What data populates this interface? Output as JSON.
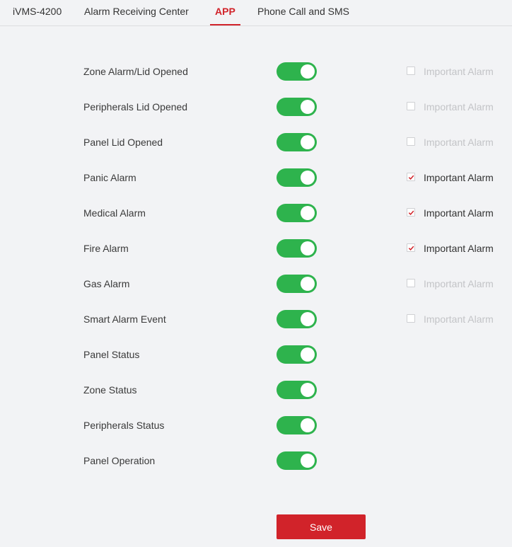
{
  "colors": {
    "accent": "#d1232a",
    "toggle_on": "#2eb34d",
    "save_bg": "#d1232a",
    "check_color": "#d1232a"
  },
  "tabs": [
    {
      "label": "iVMS-4200",
      "active": false
    },
    {
      "label": "Alarm Receiving Center",
      "active": false
    },
    {
      "label": "APP",
      "active": true
    },
    {
      "label": "Phone Call and SMS",
      "active": false
    }
  ],
  "rows": [
    {
      "label": "Zone Alarm/Lid Opened",
      "enabled": true,
      "important": {
        "label": "Important Alarm",
        "checked": false
      }
    },
    {
      "label": "Peripherals Lid Opened",
      "enabled": true,
      "important": {
        "label": "Important Alarm",
        "checked": false
      }
    },
    {
      "label": "Panel Lid Opened",
      "enabled": true,
      "important": {
        "label": "Important Alarm",
        "checked": false
      }
    },
    {
      "label": "Panic Alarm",
      "enabled": true,
      "important": {
        "label": "Important Alarm",
        "checked": true
      }
    },
    {
      "label": "Medical Alarm",
      "enabled": true,
      "important": {
        "label": "Important Alarm",
        "checked": true
      }
    },
    {
      "label": "Fire Alarm",
      "enabled": true,
      "important": {
        "label": "Important Alarm",
        "checked": true
      }
    },
    {
      "label": "Gas Alarm",
      "enabled": true,
      "important": {
        "label": "Important Alarm",
        "checked": false
      }
    },
    {
      "label": "Smart Alarm Event",
      "enabled": true,
      "important": {
        "label": "Important Alarm",
        "checked": false
      }
    },
    {
      "label": "Panel Status",
      "enabled": true
    },
    {
      "label": "Zone Status",
      "enabled": true
    },
    {
      "label": "Peripherals Status",
      "enabled": true
    },
    {
      "label": "Panel Operation",
      "enabled": true
    }
  ],
  "save_label": "Save"
}
